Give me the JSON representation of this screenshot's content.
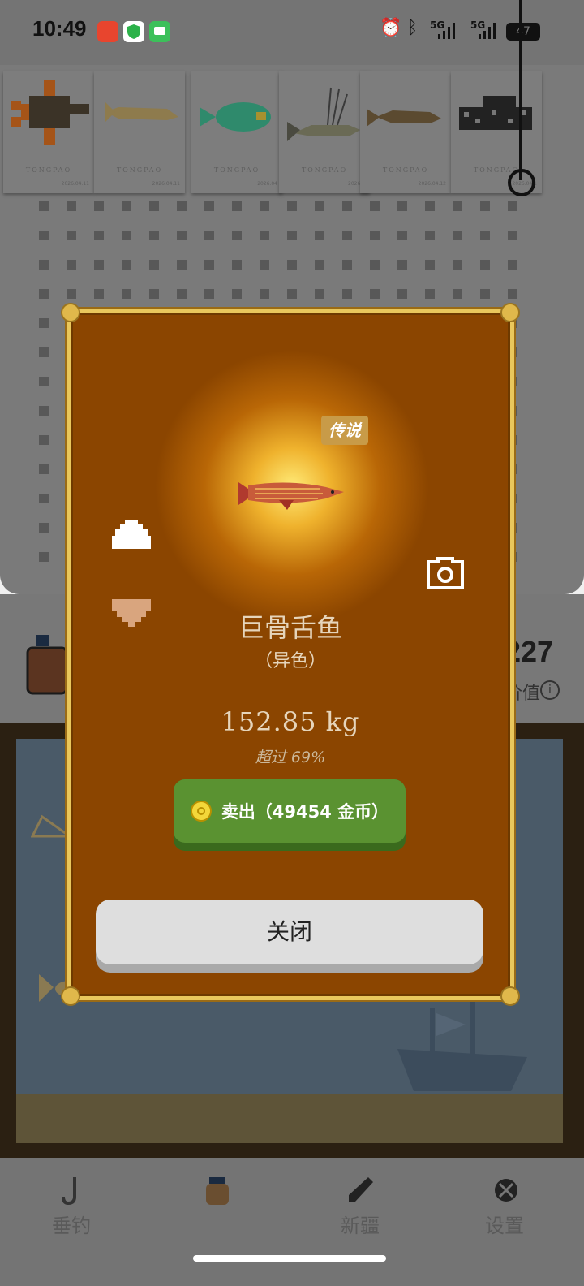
{
  "status_bar": {
    "time": "10:49",
    "network_left": "5G",
    "network_right": "5G",
    "battery": "47"
  },
  "collection_cards": [
    {
      "brand": "TONGPAO",
      "date": "2026.04.11",
      "fish_icon": "flatfish-icon"
    },
    {
      "brand": "TONGPAO",
      "date": "2026.04.11",
      "fish_icon": "sturgeon-icon"
    },
    {
      "brand": "TONGPAO",
      "date": "2026.04",
      "fish_icon": "parrotfish-icon"
    },
    {
      "brand": "TONGPAO",
      "date": "2026.0",
      "fish_icon": "roosterfish-icon"
    },
    {
      "brand": "TONGPAO",
      "date": "2026.04.12",
      "fish_icon": "catfish-icon"
    },
    {
      "brand": "TONGPAO",
      "date": "2026.04.1",
      "fish_icon": "pleco-icon"
    }
  ],
  "coins_partial": "227",
  "value_label_partial": "价值",
  "modal": {
    "rarity": "传说",
    "fish_name": "巨骨舌鱼",
    "variant": "（异色）",
    "weight": "152.85 kg",
    "exceed": "超过 69%",
    "sell_label": "卖出（49454 金币）",
    "close_label": "关闭",
    "colors": {
      "panel": "#8b4500",
      "border": "#e9c75c",
      "sell": "#5a9231",
      "close": "#dedede"
    }
  },
  "nav": {
    "items": [
      {
        "label": "垂钓",
        "icon": "fishhook-icon"
      },
      {
        "label": "",
        "icon": "bait-jar-icon"
      },
      {
        "label": "新疆",
        "icon": "bottle-icon"
      },
      {
        "label": "设置",
        "icon": "settings-icon"
      }
    ]
  }
}
